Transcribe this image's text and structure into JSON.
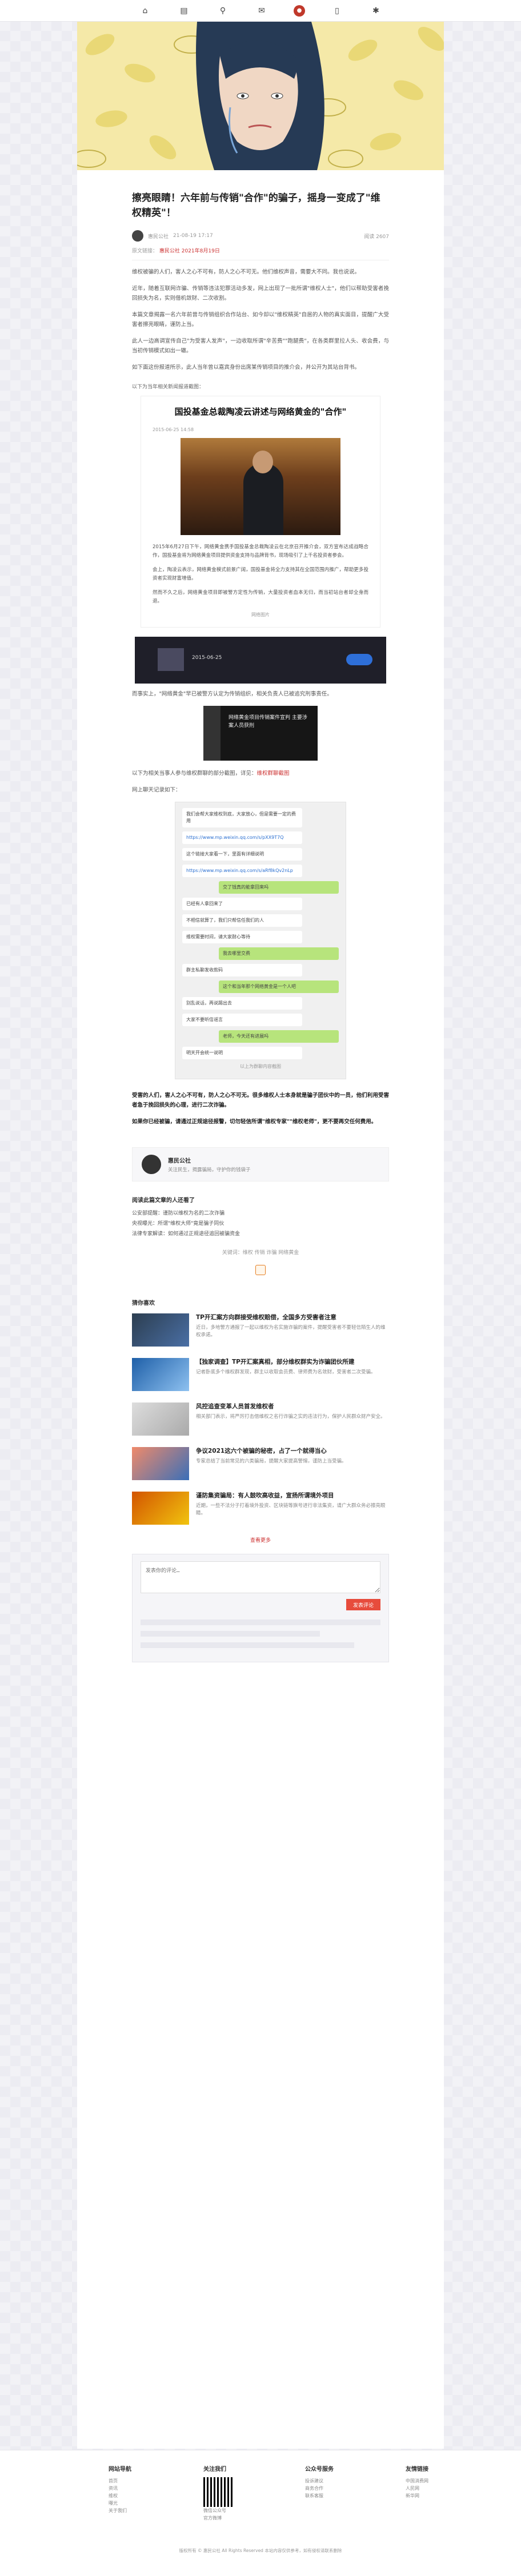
{
  "article": {
    "title": "擦亮眼睛！六年前与传销\"合作\"的骗子，摇身一变成了\"维权精英\"！",
    "author": "惠民公社",
    "time": "21-08-19 17:17",
    "views": "阅读 2607",
    "source_label": "原文链接：",
    "source_link": "惠民公社 2021年8月19日",
    "p1": "维权被骗的人们，害人之心不可有，防人之心不可无。他们维权声音，需要大不同。我也说说。",
    "p2": "近年，随着互联网诈骗、传销等违法犯罪活动多发，网上出现了一批所谓\"维权人士\"，他们以帮助受害者挽回损失为名，实则借机敛财、二次收割。",
    "p3": "本篇文章揭露一名六年前曾与传销组织合作站台、如今却以\"维权精英\"自居的人物的真实面目，提醒广大受害者擦亮眼睛，谨防上当。",
    "p4": "此人一边高调宣传自己\"为受害人发声\"，一边收取所谓\"辛苦费\"\"跑腿费\"，在各类群里拉人头、收会费，与当初传销模式如出一辙。",
    "p5": "如下面这份报道所示，此人当年曾以嘉宾身份出席某传销项目的推介会，并公开为其站台背书。",
    "caption1": "以下为当年相关新闻报道截图：",
    "img_title": "国投基金总裁陶凌云讲述与网络黄金的\"合作\"",
    "img_date": "2015-06-25 14:58",
    "img_p1": "2015年6月27日下午，网络黄金携手国投基金总裁陶凌云在北京召开推介会，双方宣布达成战略合作，国投基金将为网络黄金项目提供资金支持与品牌背书，现场吸引了上千名投资者参会。",
    "img_p2": "会上，陶凌云表示，网络黄金模式前景广阔，国投基金将全力支持其在全国范围内推广，帮助更多投资者实现财富增值。",
    "img_p3": "然而不久之后，网络黄金项目即被警方定性为传销，大量投资者血本无归，而当初站台者却全身而退。",
    "img_watermark": "网络图片",
    "video_date": "2015-06-25",
    "p6": "而事实上，\"网络黄金\"早已被警方认定为传销组织，相关负责人已被追究刑事责任。",
    "card_text": "网络黄金项目传销案件宣判 主要涉案人员获刑",
    "p7_prefix": "以下为相关当事人参与维权群聊的部分截图，详见：",
    "p7_link": "维权群聊截图",
    "p8": "网上聊天记录如下：",
    "chat": [
      "我们会帮大家维权到底，大家放心，但是需要一定的费用",
      "https://www.mp.weixin.qq.com/s/pXX9T7Q",
      "这个链接大家看一下，里面有详细说明",
      "https://www.mp.weixin.qq.com/s/aRf8kQv2nLp",
      "交了钱真的能拿回来吗",
      "已经有人拿回来了",
      "不相信就算了，我们只帮信任我们的人",
      "维权需要时间，请大家耐心等待",
      "我去哪里交费",
      "群主私聊发收款码",
      "这个和当年那个网络黄金是一个人吧",
      "别乱说话，再说踢出去",
      "大家不要听信谣言",
      "老师，今天还有进展吗",
      "明天开会统一说明"
    ],
    "chat_note": "以上为群聊内容截图",
    "p9": "受害的人们，害人之心不可有，防人之心不可无。很多维权人士本身就是骗子团伙中的一员，他们利用受害者急于挽回损失的心理，进行二次诈骗。",
    "p10": "如果你已经被骗，请通过正规途径报警，切勿轻信所谓\"维权专家\"\"维权老师\"，更不要再交任何费用。",
    "author_name": "惠民公社",
    "author_bio": "关注民生，揭露骗局，守护你的钱袋子",
    "related_head": "阅读此篇文章的人还看了",
    "related": [
      "公安部提醒：谨防以维权为名的二次诈骗",
      "央视曝光：所谓\"维权大师\"竟是骗子同伙",
      "法律专家解读：如何通过正规途径追回被骗资金"
    ],
    "keywords": "关键词：维权 传销 诈骗 网络黄金",
    "rec_head": "猜你喜欢",
    "recs": [
      {
        "t": "TP开汇案方向群接受维权赔偿，全国多方受害者注意",
        "d": "近日，多地警方通报了一起以维权为名实施诈骗的案件，提醒受害者不要轻信陌生人的维权承诺。"
      },
      {
        "t": "【独家调查】TP开汇案真相，部分维权群实为诈骗团伙所建",
        "d": "记者卧底多个维权群发现，群主以收取会员费、律师费为名敛财，受害者二次受骗。"
      },
      {
        "t": "风控追查变革人员首发维权者",
        "d": "相关部门表示，将严厉打击借维权之名行诈骗之实的违法行为，保护人民群众财产安全。"
      },
      {
        "t": "争议2021这六个被骗的秘密，占了一个就得当心",
        "d": "专家总结了当前常见的六类骗局，提醒大家提高警惕，谨防上当受骗。"
      },
      {
        "t": "谨防集资骗局：有人鼓吹高收益，宣扬所谓境外项目",
        "d": "近期，一些不法分子打着境外投资、区块链等旗号进行非法集资，请广大群众务必擦亮眼睛。"
      }
    ],
    "more": "查看更多"
  },
  "comment": {
    "placeholder": "发表你的评论…",
    "submit": "发表评论"
  },
  "footer": {
    "cols": [
      {
        "h": "网站导航",
        "items": [
          "首页",
          "资讯",
          "维权",
          "曝光",
          "关于我们"
        ]
      },
      {
        "h": "关注我们",
        "items": [
          "微信公众号",
          "官方微博"
        ]
      },
      {
        "h": "公众号服务",
        "items": [
          "投诉建议",
          "商务合作",
          "联系客服"
        ]
      },
      {
        "h": "友情链接",
        "items": [
          "中国消费网",
          "人民网",
          "新华网"
        ]
      }
    ],
    "copyright": "版权所有 © 惠民公社 All Rights Reserved 本站内容仅供参考，如有侵权请联系删除"
  },
  "colors": {
    "accent": "#c33",
    "hero": "#f5e9a8"
  }
}
